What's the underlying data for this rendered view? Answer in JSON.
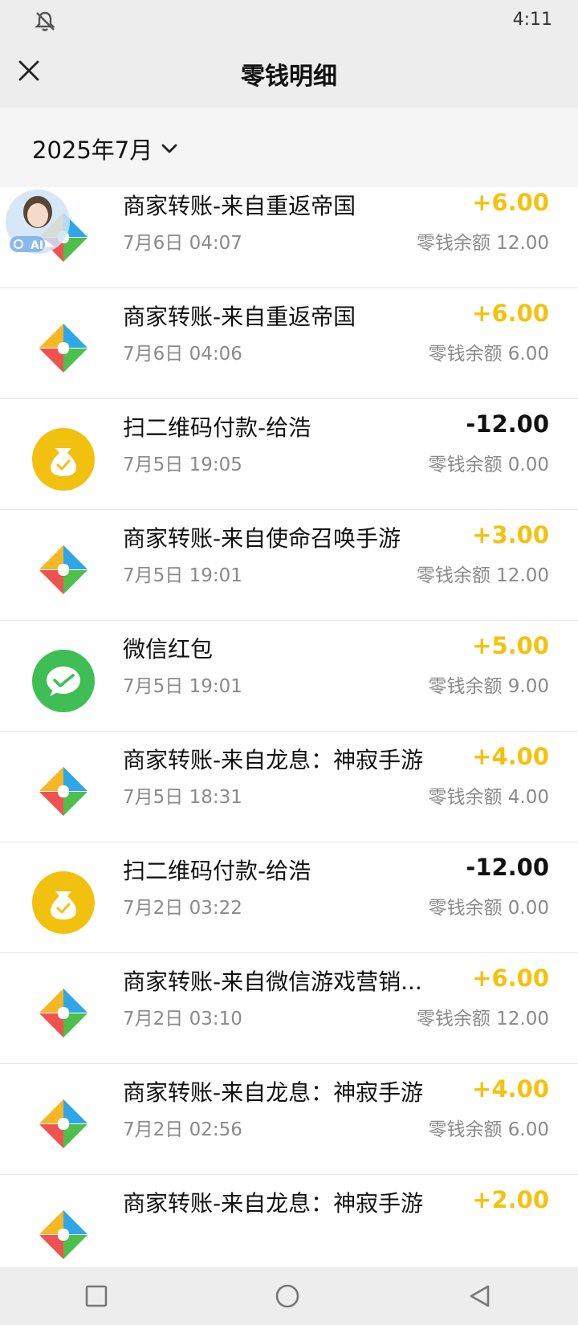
{
  "status_bar": {
    "time": "4:11",
    "icon": "bell-off-icon"
  },
  "header": {
    "title": "零钱明细",
    "close_icon": "close-icon"
  },
  "filter": {
    "month": "2025年7月",
    "chevron_icon": "chevron-down-icon"
  },
  "ai_avatar": {
    "label": "AI"
  },
  "transactions": [
    {
      "icon": "merchant-transfer-icon",
      "name": "商家转账-来自重返帝国",
      "date": "7月6日 04:07",
      "amount": "+6.00",
      "direction": "in",
      "balance": "零钱余额 12.00"
    },
    {
      "icon": "merchant-transfer-icon",
      "name": "商家转账-来自重返帝国",
      "date": "7月6日 04:06",
      "amount": "+6.00",
      "direction": "in",
      "balance": "零钱余额 6.00"
    },
    {
      "icon": "payment-bag-icon",
      "name": "扫二维码付款-给浩",
      "date": "7月5日 19:05",
      "amount": "-12.00",
      "direction": "out",
      "balance": "零钱余额 0.00"
    },
    {
      "icon": "merchant-transfer-icon",
      "name": "商家转账-来自使命召唤手游",
      "date": "7月5日 19:01",
      "amount": "+3.00",
      "direction": "in",
      "balance": "零钱余额 12.00"
    },
    {
      "icon": "wechat-redpacket-icon",
      "name": "微信红包",
      "date": "7月5日 19:01",
      "amount": "+5.00",
      "direction": "in",
      "balance": "零钱余额 9.00"
    },
    {
      "icon": "merchant-transfer-icon",
      "name": "商家转账-来自龙息：神寂手游",
      "date": "7月5日 18:31",
      "amount": "+4.00",
      "direction": "in",
      "balance": "零钱余额 4.00"
    },
    {
      "icon": "payment-bag-icon",
      "name": "扫二维码付款-给浩",
      "date": "7月2日 03:22",
      "amount": "-12.00",
      "direction": "out",
      "balance": "零钱余额 0.00"
    },
    {
      "icon": "merchant-transfer-icon",
      "name": "商家转账-来自微信游戏营销...",
      "date": "7月2日 03:10",
      "amount": "+6.00",
      "direction": "in",
      "balance": "零钱余额 12.00"
    },
    {
      "icon": "merchant-transfer-icon",
      "name": "商家转账-来自龙息：神寂手游",
      "date": "7月2日 02:56",
      "amount": "+4.00",
      "direction": "in",
      "balance": "零钱余额 6.00"
    },
    {
      "icon": "merchant-transfer-icon",
      "name": "商家转账-来自龙息：神寂手游",
      "date": "",
      "amount": "+2.00",
      "direction": "in",
      "balance": ""
    }
  ],
  "colors": {
    "positive": "#f4c20d",
    "negative": "#111111",
    "header_bg": "#ededed"
  },
  "nav_bar": {
    "icons": [
      "square-icon",
      "circle-icon",
      "back-triangle-icon"
    ]
  }
}
